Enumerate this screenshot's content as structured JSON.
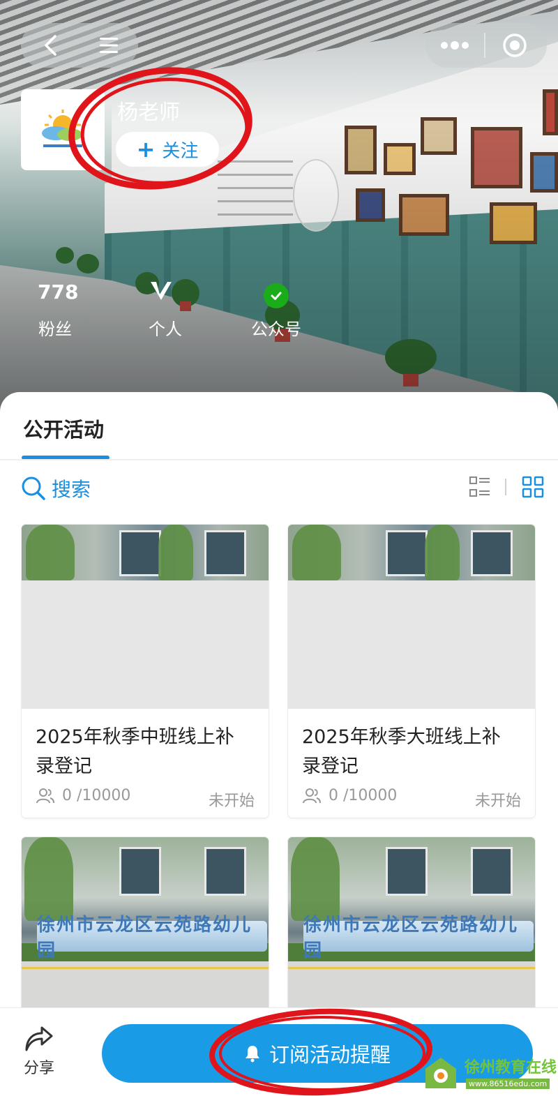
{
  "colors": {
    "accent": "#1a9be6",
    "annotation_red": "#e0141b",
    "wechat_green": "#1aad19"
  },
  "profile": {
    "name": "杨老师",
    "follow_label": "关注",
    "stats": [
      {
        "value": "778",
        "label": "粉丝"
      },
      {
        "value": "",
        "label": "个人",
        "icon": "v-verified-icon"
      },
      {
        "value": "",
        "label": "公众号",
        "icon": "wechat-verified-icon"
      }
    ]
  },
  "tabs": {
    "active": "公开活动"
  },
  "search": {
    "label": "搜索"
  },
  "activities": [
    {
      "title": "2025年秋季中班线上补录登记",
      "participants": "0 /10000",
      "status": "未开始"
    },
    {
      "title": "2025年秋季大班线上补录登记",
      "participants": "0 /10000",
      "status": "未开始"
    },
    {
      "image_text": "徐州市云龙区云苑路幼儿园"
    },
    {
      "image_text": "徐州市云龙区云苑路幼儿园"
    }
  ],
  "bottom": {
    "share_label": "分享",
    "subscribe_label": "订阅活动提醒"
  },
  "watermark": {
    "text": "徐州教育在线",
    "url": "www.86516edu.com"
  }
}
